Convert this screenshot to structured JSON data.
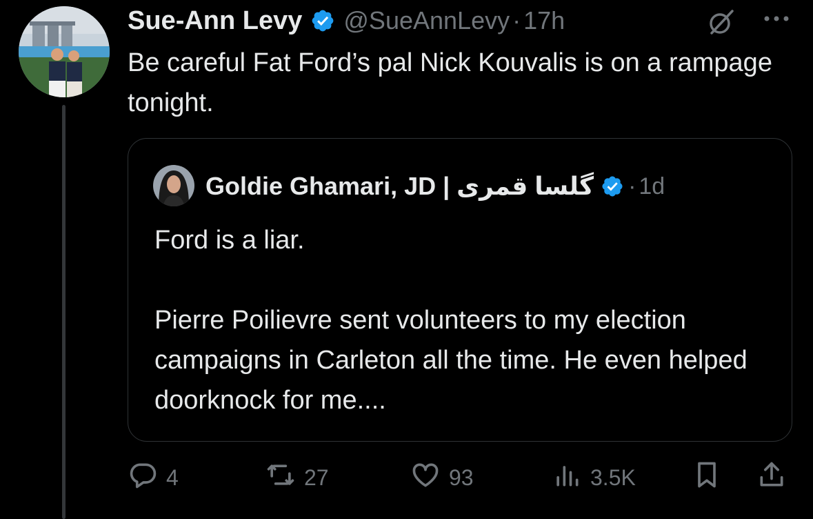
{
  "author": {
    "name": "Sue-Ann Levy",
    "handle": "@SueAnnLevy",
    "separator": "·",
    "time": "17h"
  },
  "tweet": {
    "text": "Be careful Fat Ford’s pal Nick Kouvalis is on a rampage tonight."
  },
  "quoted": {
    "name": "Goldie Ghamari, JD | گلسا قمری",
    "separator": "·",
    "time": "1d",
    "text": "Ford is a liar.\n\nPierre Poilievre sent volunteers to my election campaigns in Carleton all the time. He even helped doorknock for me...."
  },
  "actions": {
    "replies": "4",
    "reposts": "27",
    "likes": "93",
    "views": "3.5K"
  },
  "icons": [
    "verified-badge-icon",
    "grok-icon",
    "more-icon",
    "reply-icon",
    "repost-icon",
    "like-icon",
    "views-icon",
    "bookmark-icon",
    "share-icon"
  ],
  "colors": {
    "background": "#000000",
    "text": "#e7e9ea",
    "muted": "#71767b",
    "verified": "#1d9bf0",
    "border": "#2f3336"
  }
}
